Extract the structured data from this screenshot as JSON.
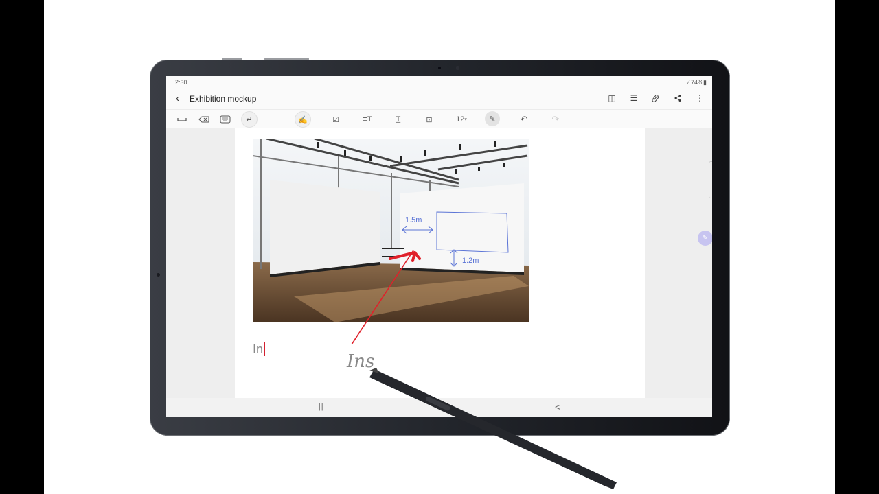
{
  "status_bar": {
    "time": "2:30",
    "battery": "74%"
  },
  "app_bar": {
    "title": "Exhibition mockup",
    "back_icon": "chevron-left-icon",
    "actions": [
      {
        "name": "book-view-icon",
        "glyph": "◫"
      },
      {
        "name": "page-list-icon",
        "glyph": "☰"
      },
      {
        "name": "attach-icon",
        "glyph": "⌇"
      },
      {
        "name": "share-icon",
        "glyph": "<"
      },
      {
        "name": "more-icon",
        "glyph": "⋮"
      }
    ]
  },
  "toolbar": {
    "left_keys": [
      {
        "name": "space-key",
        "glyph": "␣"
      },
      {
        "name": "backspace-key",
        "glyph": "⌫"
      },
      {
        "name": "keyboard-key",
        "glyph": "⌨"
      },
      {
        "name": "enter-key",
        "glyph": "↵"
      }
    ],
    "tools": [
      {
        "name": "handwriting-icon",
        "glyph": "✍"
      },
      {
        "name": "checkbox-icon",
        "glyph": "☑"
      },
      {
        "name": "text-style-icon",
        "glyph": "≡T"
      },
      {
        "name": "underline-text-icon",
        "glyph": "T̲"
      },
      {
        "name": "text-box-icon",
        "glyph": "⊡"
      }
    ],
    "font_size": "12",
    "font_size_caret": "▾",
    "pen_icon": "✎",
    "undo_icon": "↶",
    "redo_icon": "↷"
  },
  "note": {
    "image_annotations": {
      "width_label": "1.5m",
      "height_label": "1.2m"
    },
    "typed_text": "In",
    "handwriting_text": "Ins"
  },
  "nav_bar": {
    "recent": "|||",
    "back": "<"
  },
  "floating_button_icon": "✎"
}
